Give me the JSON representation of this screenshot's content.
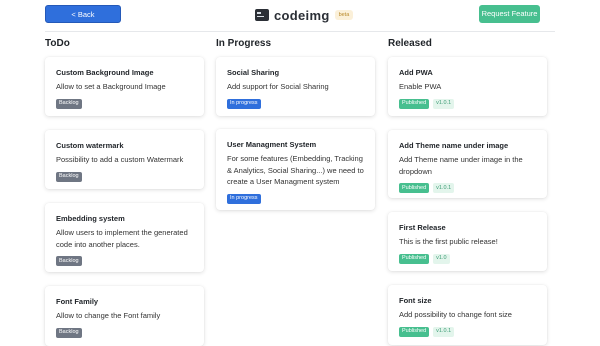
{
  "header": {
    "back_label": "< Back",
    "logo_text": "codeimg",
    "beta_label": "beta",
    "request_label": "Request Feature"
  },
  "columns": [
    {
      "title": "ToDo",
      "cards": [
        {
          "title": "Custom Background Image",
          "desc": "Allow to set a Background Image",
          "badge": "Backlog"
        },
        {
          "title": "Custom watermark",
          "desc": "Possibility to add a custom Watermark",
          "badge": "Backlog"
        },
        {
          "title": "Embedding system",
          "desc": "Allow users to implement the generated code into another places.",
          "badge": "Backlog"
        },
        {
          "title": "Font Family",
          "desc": "Allow to change the Font family",
          "badge": "Backlog"
        }
      ]
    },
    {
      "title": "In Progress",
      "cards": [
        {
          "title": "Social Sharing",
          "desc": "Add support for Social Sharing",
          "badge": "In progress"
        },
        {
          "title": "User Managment System",
          "desc": "For some features (Embedding, Tracking & Analytics, Social Sharing...) we need to create a User Managment system",
          "badge": "In progress"
        }
      ]
    },
    {
      "title": "Released",
      "cards": [
        {
          "title": "Add PWA",
          "desc": "Enable PWA",
          "badge": "Published",
          "version": "v1.0.1"
        },
        {
          "title": "Add Theme name under image",
          "desc": "Add Theme name under image in the dropdown",
          "badge": "Published",
          "version": "v1.0.1"
        },
        {
          "title": "First Release",
          "desc": "This is the first public release!",
          "badge": "Published",
          "version": "v1.0"
        },
        {
          "title": "Font size",
          "desc": "Add possibility to change font size",
          "badge": "Published",
          "version": "v1.0.1"
        }
      ]
    }
  ],
  "colors": {
    "primary": "#2f6fdc",
    "success": "#47bf8f",
    "backlog": "#6f7683"
  }
}
